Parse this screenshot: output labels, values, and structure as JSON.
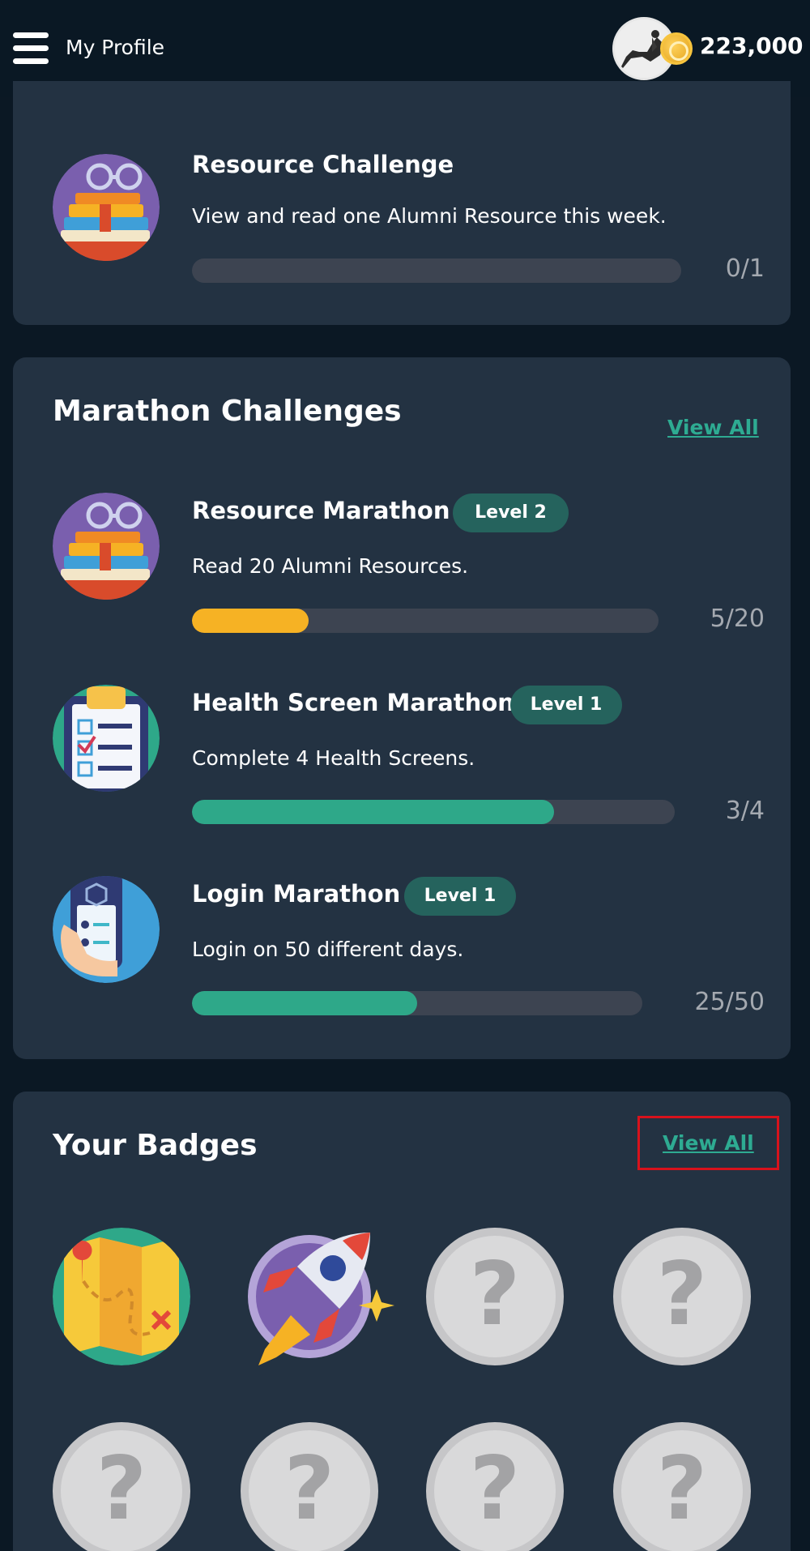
{
  "header": {
    "title": "My Profile",
    "points": "223,000",
    "menu_icon": "hamburger-menu-icon",
    "avatar_icon": "user-avatar-horse-rider",
    "coin_icon": "coin-icon"
  },
  "weekly_challenge": {
    "name": "Resource Challenge",
    "description": "View and read one Alumni Resource this week.",
    "progress_text": "0/1",
    "progress_fraction": 0,
    "icon": "books-icon"
  },
  "marathon": {
    "title": "Marathon Challenges",
    "view_all": "View All",
    "items": [
      {
        "name": "Resource Marathon",
        "level": "Level 2",
        "description": "Read 20 Alumni Resources.",
        "progress_text": "5/20",
        "progress_fraction": 0.25,
        "bar_color": "#f6b224",
        "icon": "books-icon"
      },
      {
        "name": "Health Screen Marathon",
        "level": "Level 1",
        "description": "Complete 4 Health Screens.",
        "progress_text": "3/4",
        "progress_fraction": 0.75,
        "bar_color": "#2ea889",
        "icon": "clipboard-checklist-icon"
      },
      {
        "name": "Login Marathon",
        "level": "Level 1",
        "description": "Login on 50 different days.",
        "progress_text": "25/50",
        "progress_fraction": 0.5,
        "bar_color": "#2ea889",
        "icon": "phone-in-hand-icon"
      }
    ]
  },
  "badges": {
    "title": "Your Badges",
    "view_all": "View All",
    "items": [
      {
        "state": "earned",
        "icon": "treasure-map-icon"
      },
      {
        "state": "earned",
        "icon": "rocket-icon"
      },
      {
        "state": "locked",
        "symbol": "?"
      },
      {
        "state": "locked",
        "symbol": "?"
      },
      {
        "state": "locked",
        "symbol": "?"
      },
      {
        "state": "locked",
        "symbol": "?"
      },
      {
        "state": "locked",
        "symbol": "?"
      },
      {
        "state": "locked",
        "symbol": "?"
      }
    ]
  },
  "colors": {
    "background": "#0b1824",
    "card": "#233242",
    "accent_green": "#2eab92",
    "level_pill": "#25635d",
    "progress_track": "#3d4451",
    "highlight_box": "#d8121c"
  }
}
